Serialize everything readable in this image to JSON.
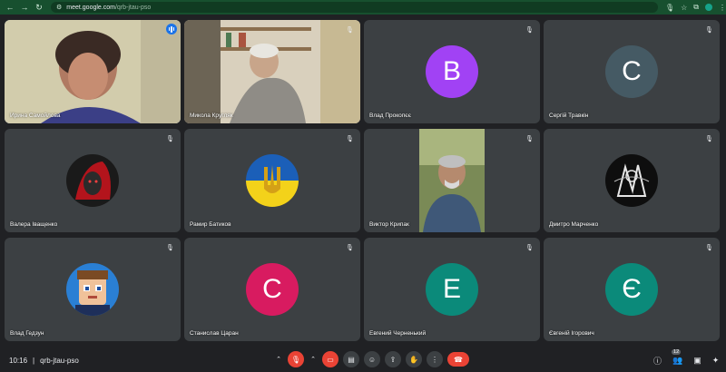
{
  "browser": {
    "url_domain": "meet.google.com",
    "url_path": "/qrb-jtau-pso",
    "profile_letter": "t"
  },
  "tiles": [
    {
      "name": "Ирина Самойлова",
      "type": "video",
      "speaking": true
    },
    {
      "name": "Микола Кругляк",
      "type": "video",
      "muted": true
    },
    {
      "name": "Влад Прокопєє",
      "type": "letter",
      "letter": "B",
      "color": "#a142f4",
      "muted": true
    },
    {
      "name": "Сергій Травкін",
      "type": "letter",
      "letter": "C",
      "color": "#455a64",
      "muted": true
    },
    {
      "name": "Валера Іващенко",
      "type": "avatar",
      "avatar": "red-dragon-avatar",
      "muted": true
    },
    {
      "name": "Рамир Батиков",
      "type": "avatar",
      "avatar": "ukraine-flag-trident-avatar",
      "muted": true
    },
    {
      "name": "Виктор Крипак",
      "type": "video",
      "muted": true
    },
    {
      "name": "Дмитро Марченко",
      "type": "avatar",
      "avatar": "black-white-art-avatar",
      "muted": true
    },
    {
      "name": "Влад Гедзун",
      "type": "avatar",
      "avatar": "cartoon-boy-avatar",
      "muted": true
    },
    {
      "name": "Станислав Царан",
      "type": "letter",
      "letter": "C",
      "color": "#d81b60",
      "muted": true
    },
    {
      "name": "Евгений Черненький",
      "type": "letter",
      "letter": "E",
      "color": "#0b8a7a",
      "muted": true
    },
    {
      "name": "Євгенiй Ігорович",
      "type": "letter",
      "letter": "Є",
      "color": "#0b8a7a",
      "muted": true
    }
  ],
  "meeting": {
    "time": "10:16",
    "separator": "|",
    "code": "qrb-jtau-pso"
  },
  "controls": {
    "participants_count": "12"
  },
  "colors": {
    "accent": "#8ab4f8",
    "danger": "#ea4335",
    "tile_bg": "#3c4043"
  }
}
